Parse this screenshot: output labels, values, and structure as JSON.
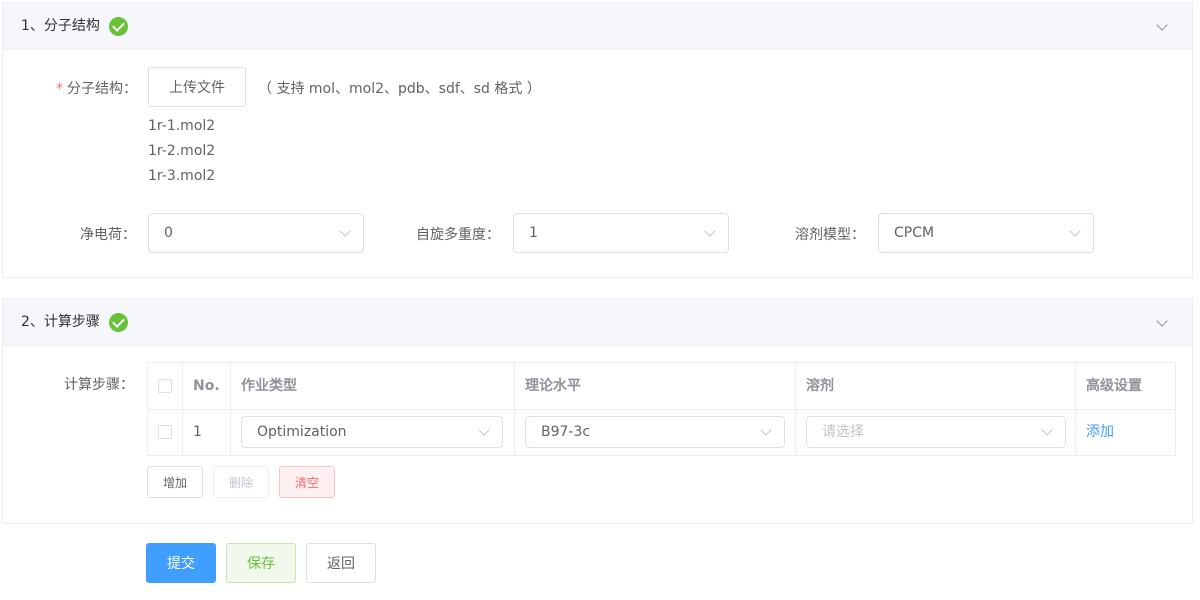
{
  "section1": {
    "title": "1、分子结构",
    "structure_label": "分子结构：",
    "upload_label": "上传文件",
    "upload_hint": "（ 支持 mol、mol2、pdb、sdf、sd 格式 ）",
    "files": [
      "1r-1.mol2",
      "1r-2.mol2",
      "1r-3.mol2"
    ],
    "charge_label": "净电荷：",
    "charge_value": "0",
    "spin_label": "自旋多重度：",
    "spin_value": "1",
    "solvent_model_label": "溶剂模型：",
    "solvent_model_value": "CPCM"
  },
  "section2": {
    "title": "2、计算步骤",
    "steps_label": "计算步骤：",
    "table": {
      "headers": [
        "No.",
        "作业类型",
        "理论水平",
        "溶剂",
        "高级设置"
      ],
      "rows": [
        {
          "no": "1",
          "job_type": "Optimization",
          "level": "B97-3c",
          "solvent_placeholder": "请选择",
          "advanced": "添加"
        }
      ]
    },
    "add_label": "增加",
    "delete_label": "删除",
    "clear_label": "清空"
  },
  "footer": {
    "submit_label": "提交",
    "save_label": "保存",
    "back_label": "返回"
  }
}
